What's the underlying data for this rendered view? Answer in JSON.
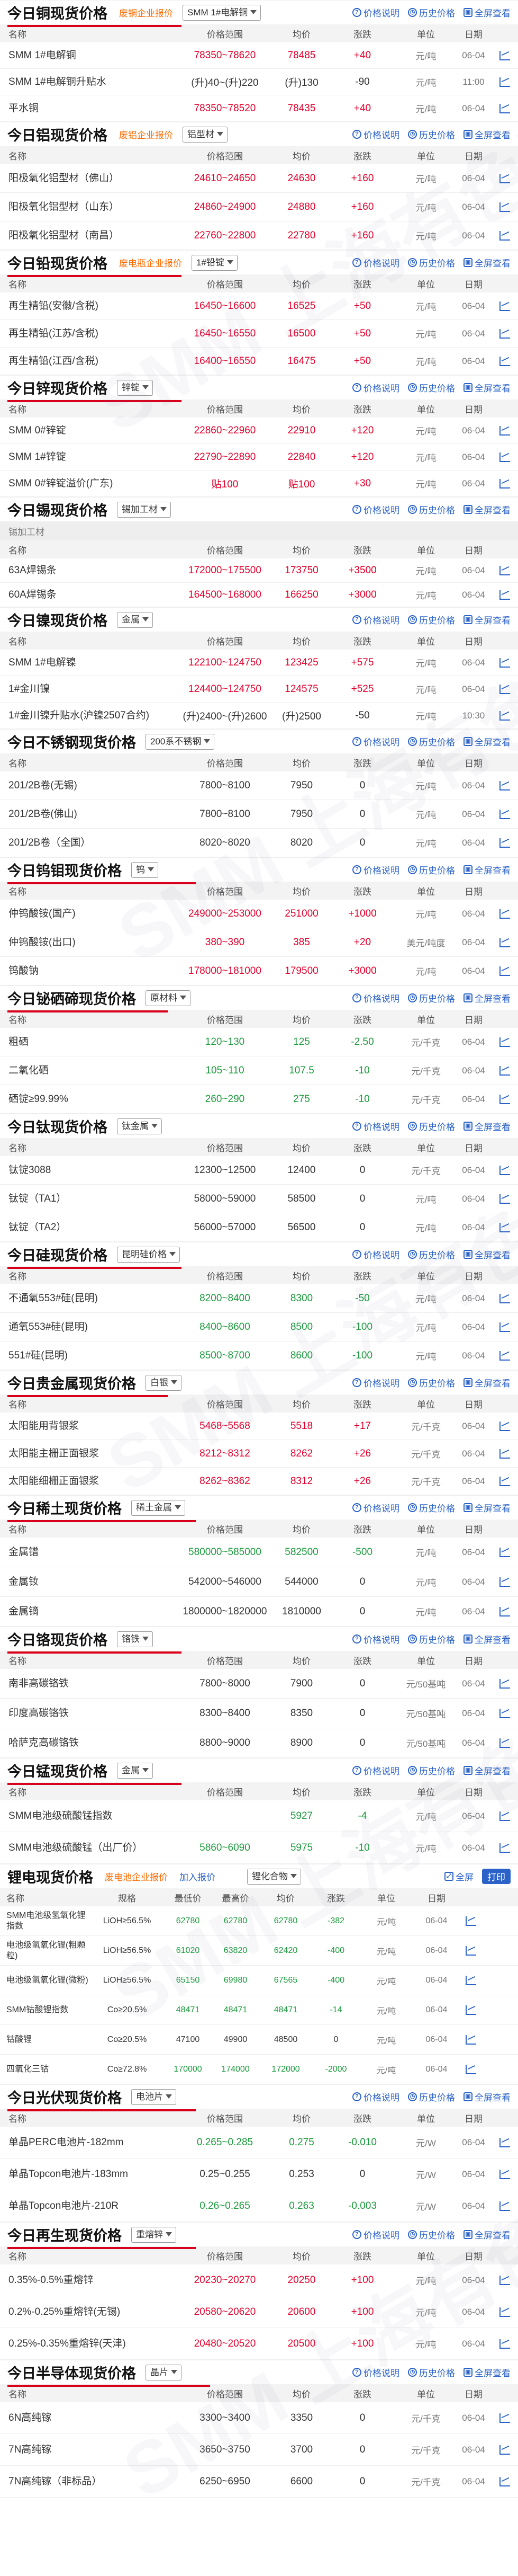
{
  "sections": [
    {
      "title": "今日铜现货价格",
      "link": "废铜企业报价",
      "select": "SMM 1#电解铜",
      "h": [
        [
          "名称",
          "价格范围",
          "均价",
          "涨跌",
          "单位",
          "日期"
        ]
      ],
      "rows": [
        [
          "SMM 1#电解铜",
          "78350~78620",
          "78485",
          "+40",
          "元/吨",
          "06-04",
          "red"
        ],
        [
          "SMM 1#电解铜升贴水",
          "(升)40~(升)220",
          "(升)130",
          "-90",
          "元/吨",
          "11:00",
          "gry"
        ],
        [
          "平水铜",
          "78350~78520",
          "78435",
          "+40",
          "元/吨",
          "06-04",
          "red"
        ]
      ]
    },
    {
      "title": "今日铝现货价格",
      "link": "废铝企业报价",
      "select": "铝型材",
      "rows": [
        [
          "阳极氧化铝型材（佛山）",
          "24610~24650",
          "24630",
          "+160",
          "元/吨",
          "06-04",
          "red"
        ],
        [
          "阳极氧化铝型材（山东）",
          "24860~24900",
          "24880",
          "+160",
          "元/吨",
          "06-04",
          "red"
        ],
        [
          "阳极氧化铝型材（南昌）",
          "22760~22800",
          "22780",
          "+160",
          "元/吨",
          "06-04",
          "red"
        ]
      ]
    },
    {
      "title": "今日铅现货价格",
      "link": "废电瓶企业报价",
      "select": "1#铅锭",
      "rows": [
        [
          "再生精铅(安徽/含税)",
          "16450~16600",
          "16525",
          "+50",
          "元/吨",
          "06-04",
          "red"
        ],
        [
          "再生精铅(江苏/含税)",
          "16450~16550",
          "16500",
          "+50",
          "元/吨",
          "06-04",
          "red"
        ],
        [
          "再生精铅(江西/含税)",
          "16400~16550",
          "16475",
          "+50",
          "元/吨",
          "06-04",
          "red"
        ]
      ]
    },
    {
      "title": "今日锌现货价格",
      "select": "锌锭",
      "rows": [
        [
          "SMM 0#锌锭",
          "22860~22960",
          "22910",
          "+120",
          "元/吨",
          "06-04",
          "red"
        ],
        [
          "SMM 1#锌锭",
          "22790~22890",
          "22840",
          "+120",
          "元/吨",
          "06-04",
          "red"
        ],
        [
          "SMM 0#锌锭溢价(广东)",
          "贴100",
          "贴100",
          "+30",
          "元/吨",
          "06-04",
          "red"
        ]
      ]
    },
    {
      "title": "今日锡现货价格",
      "select": "锡加工材",
      "sub": "锡加工材",
      "rows": [
        [
          "63A焊锡条",
          "172000~175500",
          "173750",
          "+3500",
          "元/吨",
          "06-04",
          "red"
        ],
        [
          "60A焊锡条",
          "164500~168000",
          "166250",
          "+3000",
          "元/吨",
          "06-04",
          "red"
        ]
      ]
    },
    {
      "title": "今日镍现货价格",
      "select": "金属",
      "rows": [
        [
          "SMM 1#电解镍",
          "122100~124750",
          "123425",
          "+575",
          "元/吨",
          "06-04",
          "red"
        ],
        [
          "1#金川镍",
          "124400~124750",
          "124575",
          "+525",
          "元/吨",
          "06-04",
          "red"
        ],
        [
          "1#金川镍升贴水(沪镍2507合约)",
          "(升)2400~(升)2600",
          "(升)2500",
          "-50",
          "元/吨",
          "10:30",
          "gry"
        ]
      ]
    },
    {
      "title": "今日不锈钢现货价格",
      "select": "200系不锈钢",
      "rows": [
        [
          "201/2B卷(无锡)",
          "7800~8100",
          "7950",
          "0",
          "元/吨",
          "06-04",
          "gry"
        ],
        [
          "201/2B卷(佛山)",
          "7800~8100",
          "7950",
          "0",
          "元/吨",
          "06-04",
          "gry"
        ],
        [
          "201/2B卷（全国）",
          "8020~8020",
          "8020",
          "0",
          "元/吨",
          "06-04",
          "gry"
        ]
      ]
    },
    {
      "title": "今日钨钼现货价格",
      "select": "钨",
      "rows": [
        [
          "仲钨酸铵(国产)",
          "249000~253000",
          "251000",
          "+1000",
          "元/吨",
          "06-04",
          "red"
        ],
        [
          "仲钨酸铵(出口)",
          "380~390",
          "385",
          "+20",
          "美元/吨度",
          "06-04",
          "red"
        ],
        [
          "钨酸钠",
          "178000~181000",
          "179500",
          "+3000",
          "元/吨",
          "06-04",
          "red"
        ]
      ]
    },
    {
      "title": "今日铋硒碲现货价格",
      "select": "原材料",
      "rows": [
        [
          "粗硒",
          "120~130",
          "125",
          "-2.50",
          "元/千克",
          "06-04",
          "grn"
        ],
        [
          "二氧化硒",
          "105~110",
          "107.5",
          "-10",
          "元/千克",
          "06-04",
          "grn"
        ],
        [
          "硒锭≥99.99%",
          "260~290",
          "275",
          "-10",
          "元/千克",
          "06-04",
          "grn"
        ]
      ]
    },
    {
      "title": "今日钛现货价格",
      "select": "钛金属",
      "rows": [
        [
          "钛锭3088",
          "12300~12500",
          "12400",
          "0",
          "元/千克",
          "06-04",
          "gry"
        ],
        [
          "钛锭（TA1）",
          "58000~59000",
          "58500",
          "0",
          "元/吨",
          "06-04",
          "gry"
        ],
        [
          "钛锭（TA2）",
          "56000~57000",
          "56500",
          "0",
          "元/吨",
          "06-04",
          "gry"
        ]
      ]
    },
    {
      "title": "今日硅现货价格",
      "select": "昆明硅价格",
      "rows": [
        [
          "不通氧553#硅(昆明)",
          "8200~8400",
          "8300",
          "-50",
          "元/吨",
          "06-04",
          "grn"
        ],
        [
          "通氧553#硅(昆明)",
          "8400~8600",
          "8500",
          "-100",
          "元/吨",
          "06-04",
          "grn"
        ],
        [
          "551#硅(昆明)",
          "8500~8700",
          "8600",
          "-100",
          "元/吨",
          "06-04",
          "grn"
        ]
      ]
    },
    {
      "title": "今日贵金属现货价格",
      "select": "白银",
      "rows": [
        [
          "太阳能用背银浆",
          "5468~5568",
          "5518",
          "+17",
          "元/千克",
          "06-04",
          "red"
        ],
        [
          "太阳能主栅正面银浆",
          "8212~8312",
          "8262",
          "+26",
          "元/千克",
          "06-04",
          "red"
        ],
        [
          "太阳能细栅正面银浆",
          "8262~8362",
          "8312",
          "+26",
          "元/千克",
          "06-04",
          "red"
        ]
      ]
    },
    {
      "title": "今日稀土现货价格",
      "select": "稀土金属",
      "rows": [
        [
          "金属镨",
          "580000~585000",
          "582500",
          "-500",
          "元/吨",
          "06-04",
          "grn"
        ],
        [
          "金属钕",
          "542000~546000",
          "544000",
          "0",
          "元/吨",
          "06-04",
          "gry"
        ],
        [
          "金属镝",
          "1800000~1820000",
          "1810000",
          "0",
          "元/吨",
          "06-04",
          "gry"
        ]
      ]
    },
    {
      "title": "今日铬现货价格",
      "select": "铬铁",
      "rows": [
        [
          "南非高碳铬铁",
          "7800~8000",
          "7900",
          "0",
          "元/50基吨",
          "06-04",
          "gry"
        ],
        [
          "印度高碳铬铁",
          "8300~8400",
          "8350",
          "0",
          "元/50基吨",
          "06-04",
          "gry"
        ],
        [
          "哈萨克高碳铬铁",
          "8800~9000",
          "8900",
          "0",
          "元/50基吨",
          "06-04",
          "gry"
        ]
      ]
    },
    {
      "title": "今日锰现货价格",
      "select": "金属",
      "rows": [
        [
          "SMM电池级硫酸锰指数",
          "",
          "5927",
          "-4",
          "元/吨",
          "06-04",
          "grn"
        ],
        [
          "SMM电池级硫酸锰（出厂价）",
          "5860~6090",
          "5975",
          "-10",
          "元/吨",
          "06-04",
          "grn"
        ]
      ]
    }
  ],
  "lithium": {
    "title": "锂电现货价格",
    "link1": "废电池企业报价",
    "link2": "加入报价",
    "select": "锂化合物",
    "full": "全屏",
    "print": "打印",
    "rows": [
      [
        "SMM电池级氢氧化锂指数",
        "LiOH≥56.5%",
        "62780",
        "62780",
        "62780",
        "-382",
        "元/吨",
        "06-04"
      ],
      [
        "电池级氢氧化锂(粗颗粒)",
        "LiOH≥56.5%",
        "61020",
        "63820",
        "62420",
        "-400",
        "元/吨",
        "06-04"
      ],
      [
        "电池级氢氧化锂(微粉)",
        "LiOH≥56.5%",
        "65150",
        "69980",
        "67565",
        "-400",
        "元/吨",
        "06-04"
      ],
      [
        "SMM钴酸锂指数",
        "Co≥20.5%",
        "48471",
        "48471",
        "48471",
        "-14",
        "元/吨",
        "06-04"
      ],
      [
        "钴酸锂",
        "Co≥20.5%",
        "47100",
        "49900",
        "48500",
        "0",
        "元/吨",
        "06-04"
      ],
      [
        "四氧化三钴",
        "Co≥72.8%",
        "170000",
        "174000",
        "172000",
        "-2000",
        "元/吨",
        "06-04"
      ]
    ]
  },
  "sections2": [
    {
      "title": "今日光伏现货价格",
      "select": "电池片",
      "rows": [
        [
          "单晶PERC电池片-182mm",
          "0.265~0.285",
          "0.275",
          "-0.010",
          "元/W",
          "06-04",
          "grn"
        ],
        [
          "单晶Topcon电池片-183mm",
          "0.25~0.255",
          "0.253",
          "0",
          "元/W",
          "06-04",
          "gry"
        ],
        [
          "单晶Topcon电池片-210R",
          "0.26~0.265",
          "0.263",
          "-0.003",
          "元/W",
          "06-04",
          "grn"
        ]
      ]
    },
    {
      "title": "今日再生现货价格",
      "select": "重熔锌",
      "rows": [
        [
          "0.35%-0.5%重熔锌",
          "20230~20270",
          "20250",
          "+100",
          "元/吨",
          "06-04",
          "red"
        ],
        [
          "0.2%-0.25%重熔锌(无锡)",
          "20580~20620",
          "20600",
          "+100",
          "元/吨",
          "06-04",
          "red"
        ],
        [
          "0.25%-0.35%重熔锌(天津)",
          "20480~20520",
          "20500",
          "+100",
          "元/吨",
          "06-04",
          "red"
        ]
      ]
    },
    {
      "title": "今日半导体现货价格",
      "select": "晶片",
      "rows": [
        [
          "6N高纯镓",
          "3300~3400",
          "3350",
          "0",
          "元/千克",
          "06-04",
          "gry"
        ],
        [
          "7N高纯镓",
          "3650~3750",
          "3700",
          "0",
          "元/千克",
          "06-04",
          "gry"
        ],
        [
          "7N高纯镓（非标品）",
          "6250~6950",
          "6600",
          "0",
          "元/千克",
          "06-04",
          "gry"
        ]
      ]
    }
  ],
  "headers": {
    "name": "名称",
    "range": "价格范围",
    "avg": "均价",
    "chg": "涨跌",
    "unit": "单位",
    "date": "日期"
  },
  "lith_headers": {
    "name": "名称",
    "spec": "规格",
    "low": "最低价",
    "high": "最高价",
    "avg": "均价",
    "chg": "涨跌",
    "unit": "单位",
    "date": "日期"
  },
  "tools": {
    "explain": "价格说明",
    "history": "历史价格",
    "all": "全屏查看"
  },
  "watermark": "SMM 上海有色网"
}
